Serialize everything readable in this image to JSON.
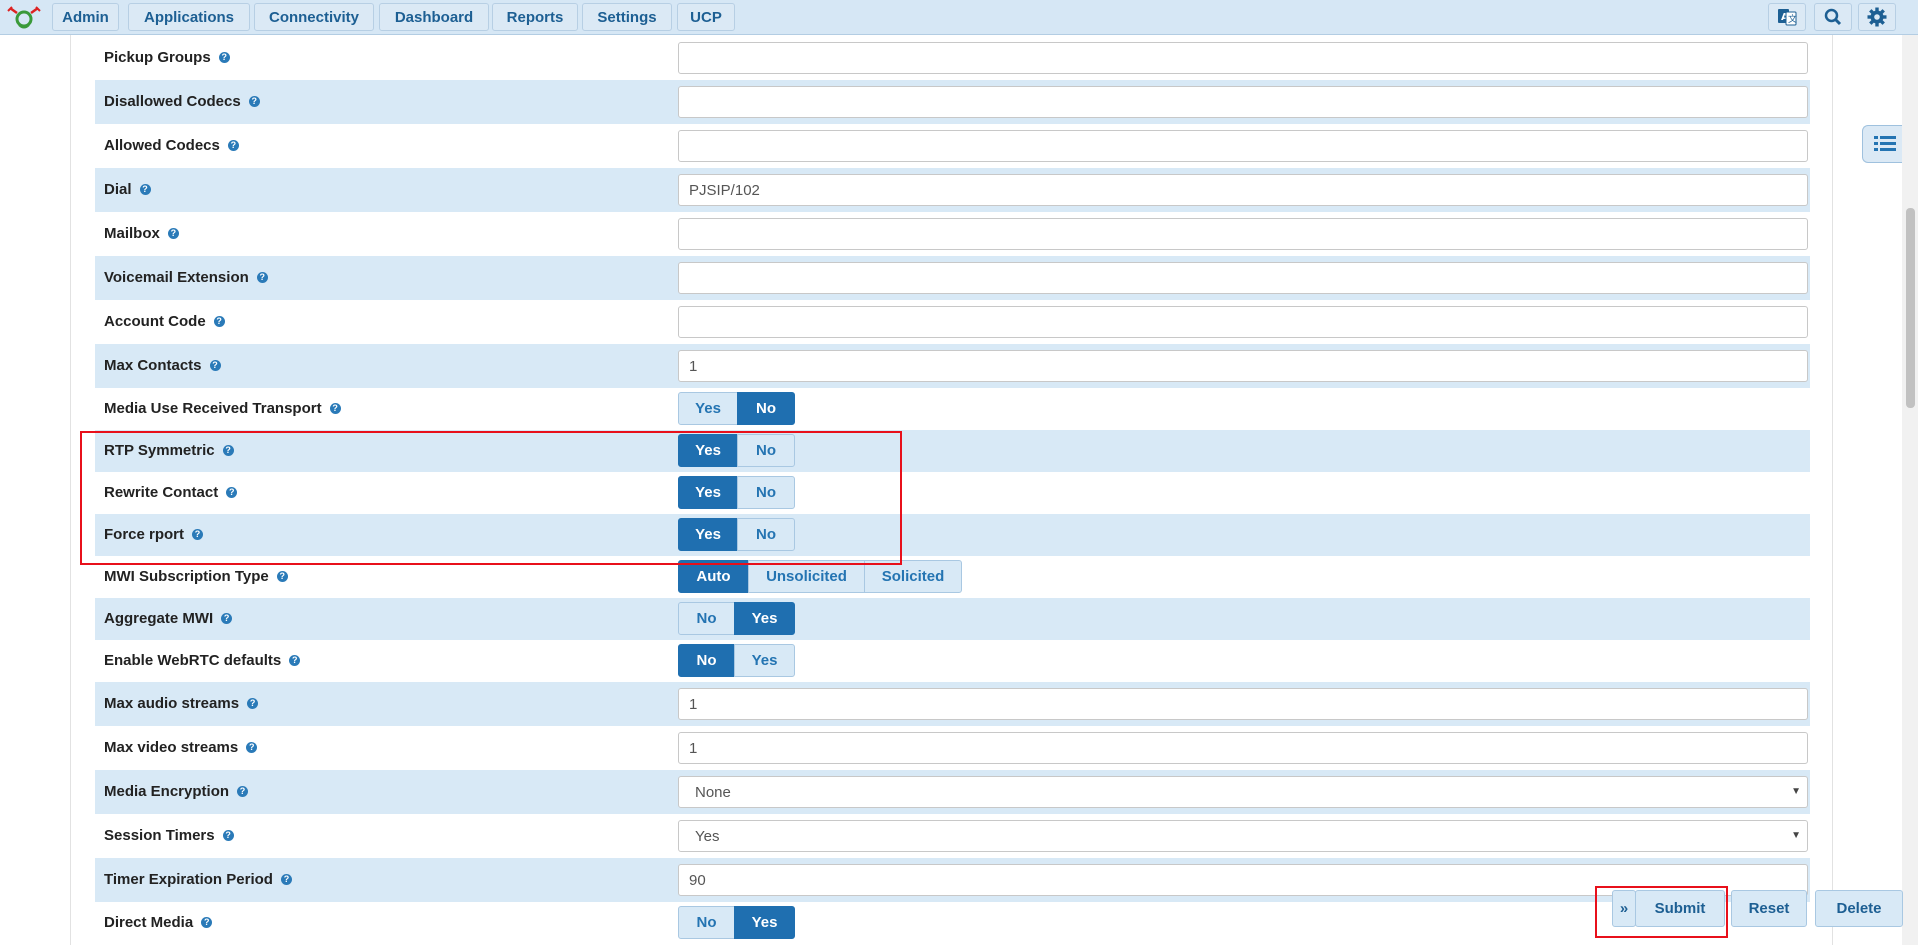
{
  "nav": {
    "items": [
      "Admin",
      "Applications",
      "Connectivity",
      "Dashboard",
      "Reports",
      "Settings",
      "UCP"
    ],
    "icons": [
      "language-icon",
      "search-icon",
      "gear-icon"
    ]
  },
  "form": {
    "pickup_groups": {
      "label": "Pickup Groups",
      "value": ""
    },
    "disallowed_codecs": {
      "label": "Disallowed Codecs",
      "value": ""
    },
    "allowed_codecs": {
      "label": "Allowed Codecs",
      "value": ""
    },
    "dial": {
      "label": "Dial",
      "value": "PJSIP/102"
    },
    "mailbox": {
      "label": "Mailbox",
      "value": ""
    },
    "voicemail_extension": {
      "label": "Voicemail Extension",
      "value": ""
    },
    "account_code": {
      "label": "Account Code",
      "value": ""
    },
    "max_contacts": {
      "label": "Max Contacts",
      "value": "1"
    },
    "media_use_received_transport": {
      "label": "Media Use Received Transport",
      "options": [
        "Yes",
        "No"
      ],
      "selected": "No"
    },
    "rtp_symmetric": {
      "label": "RTP Symmetric",
      "options": [
        "Yes",
        "No"
      ],
      "selected": "Yes"
    },
    "rewrite_contact": {
      "label": "Rewrite Contact",
      "options": [
        "Yes",
        "No"
      ],
      "selected": "Yes"
    },
    "force_rport": {
      "label": "Force rport",
      "options": [
        "Yes",
        "No"
      ],
      "selected": "Yes"
    },
    "mwi_subscription_type": {
      "label": "MWI Subscription Type",
      "options": [
        "Auto",
        "Unsolicited",
        "Solicited"
      ],
      "selected": "Auto"
    },
    "aggregate_mwi": {
      "label": "Aggregate MWI",
      "options": [
        "No",
        "Yes"
      ],
      "selected": "Yes"
    },
    "enable_webrtc_defaults": {
      "label": "Enable WebRTC defaults",
      "options": [
        "No",
        "Yes"
      ],
      "selected": "No"
    },
    "max_audio_streams": {
      "label": "Max audio streams",
      "value": "1"
    },
    "max_video_streams": {
      "label": "Max video streams",
      "value": "1"
    },
    "media_encryption": {
      "label": "Media Encryption",
      "value": "None"
    },
    "session_timers": {
      "label": "Session Timers",
      "value": "Yes"
    },
    "timer_expiration_period": {
      "label": "Timer Expiration Period",
      "value": "90"
    },
    "direct_media": {
      "label": "Direct Media",
      "options": [
        "No",
        "Yes"
      ],
      "selected": "Yes"
    }
  },
  "actions": {
    "toggle": "»",
    "submit": "Submit",
    "reset": "Reset",
    "delete": "Delete"
  },
  "colors": {
    "nav_bg": "#d6e7f5",
    "row_shade": "#d8e9f6",
    "toggle_on": "#1f6fb0",
    "accent_text": "#2474b2",
    "highlight": "#e8101b"
  }
}
